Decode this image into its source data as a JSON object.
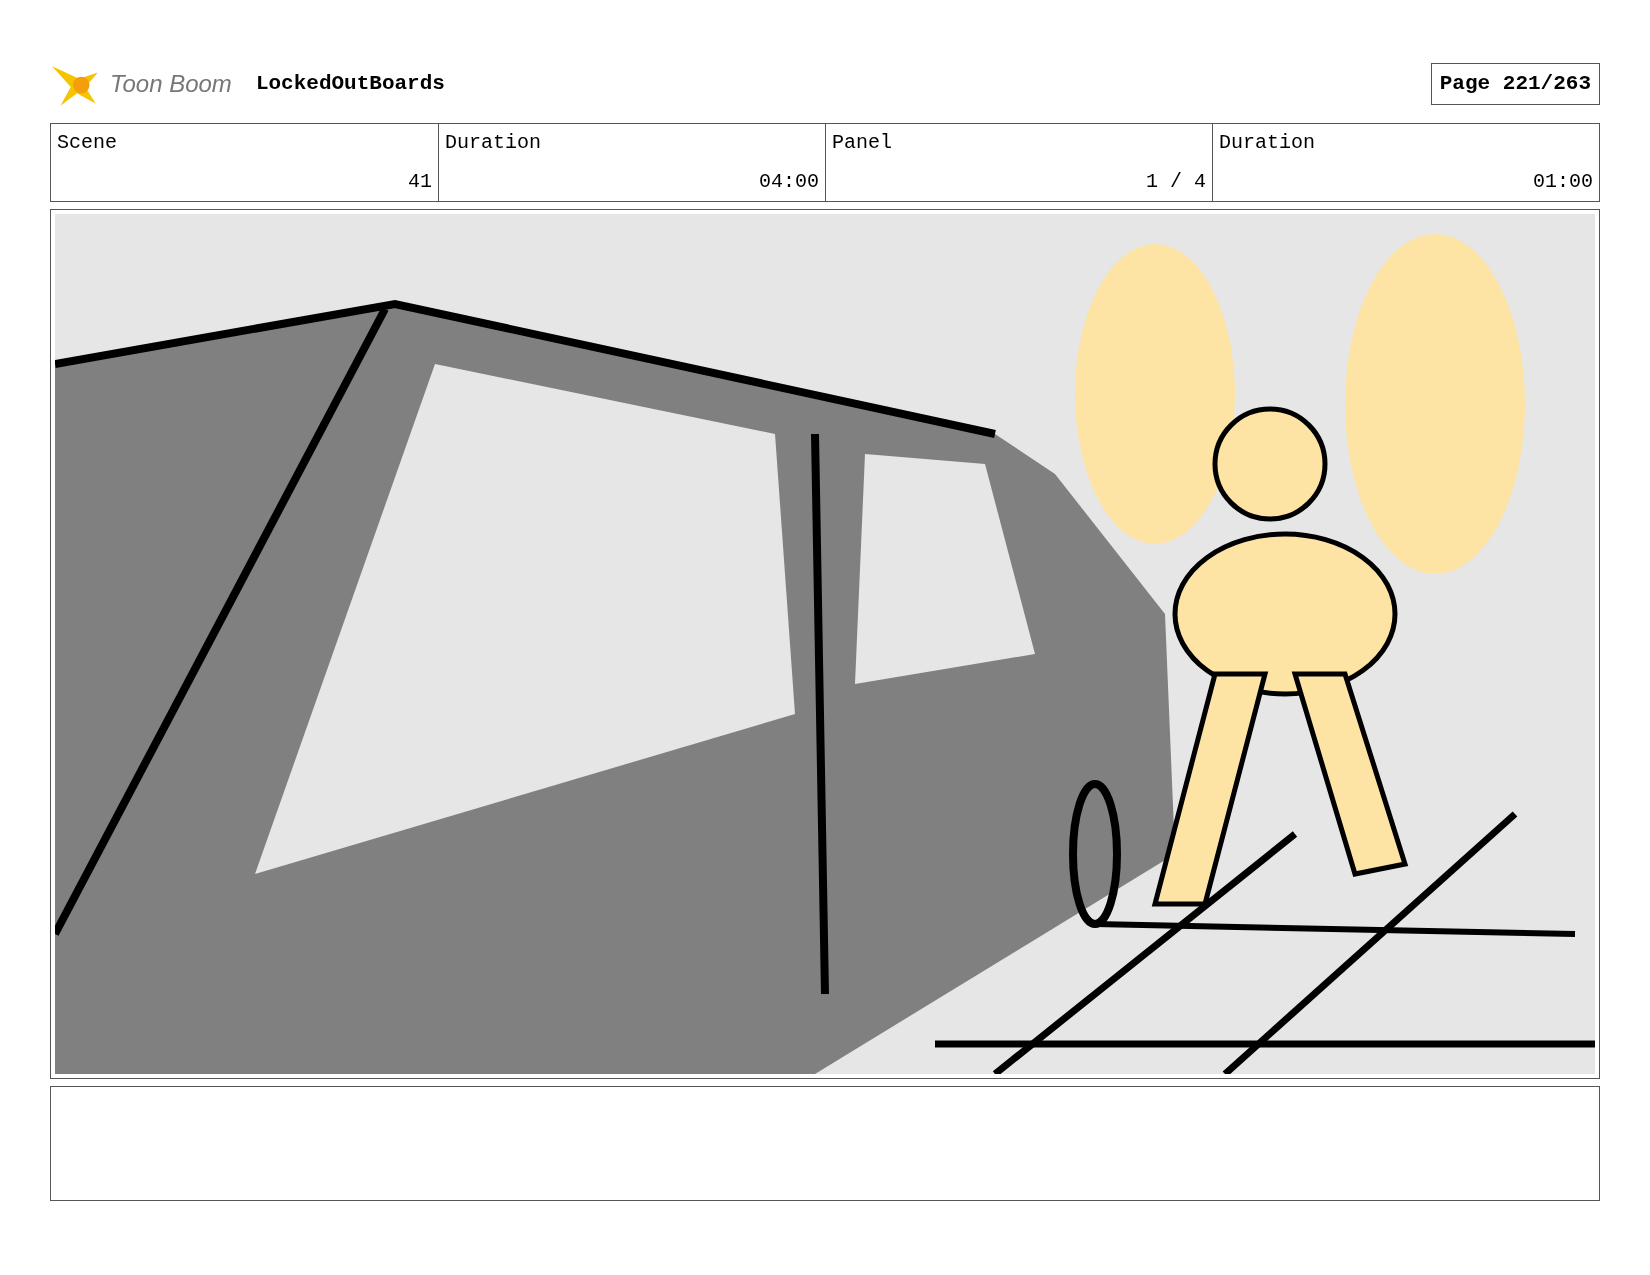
{
  "header": {
    "logo_text": "Toon Boom",
    "project": "LockedOutBoards",
    "page": "Page 221/263"
  },
  "info_table": {
    "columns": [
      "Scene",
      "Duration",
      "Panel",
      "Duration"
    ],
    "rows": [
      [
        "41",
        "04:00",
        "1 / 4",
        "01:00"
      ]
    ]
  }
}
